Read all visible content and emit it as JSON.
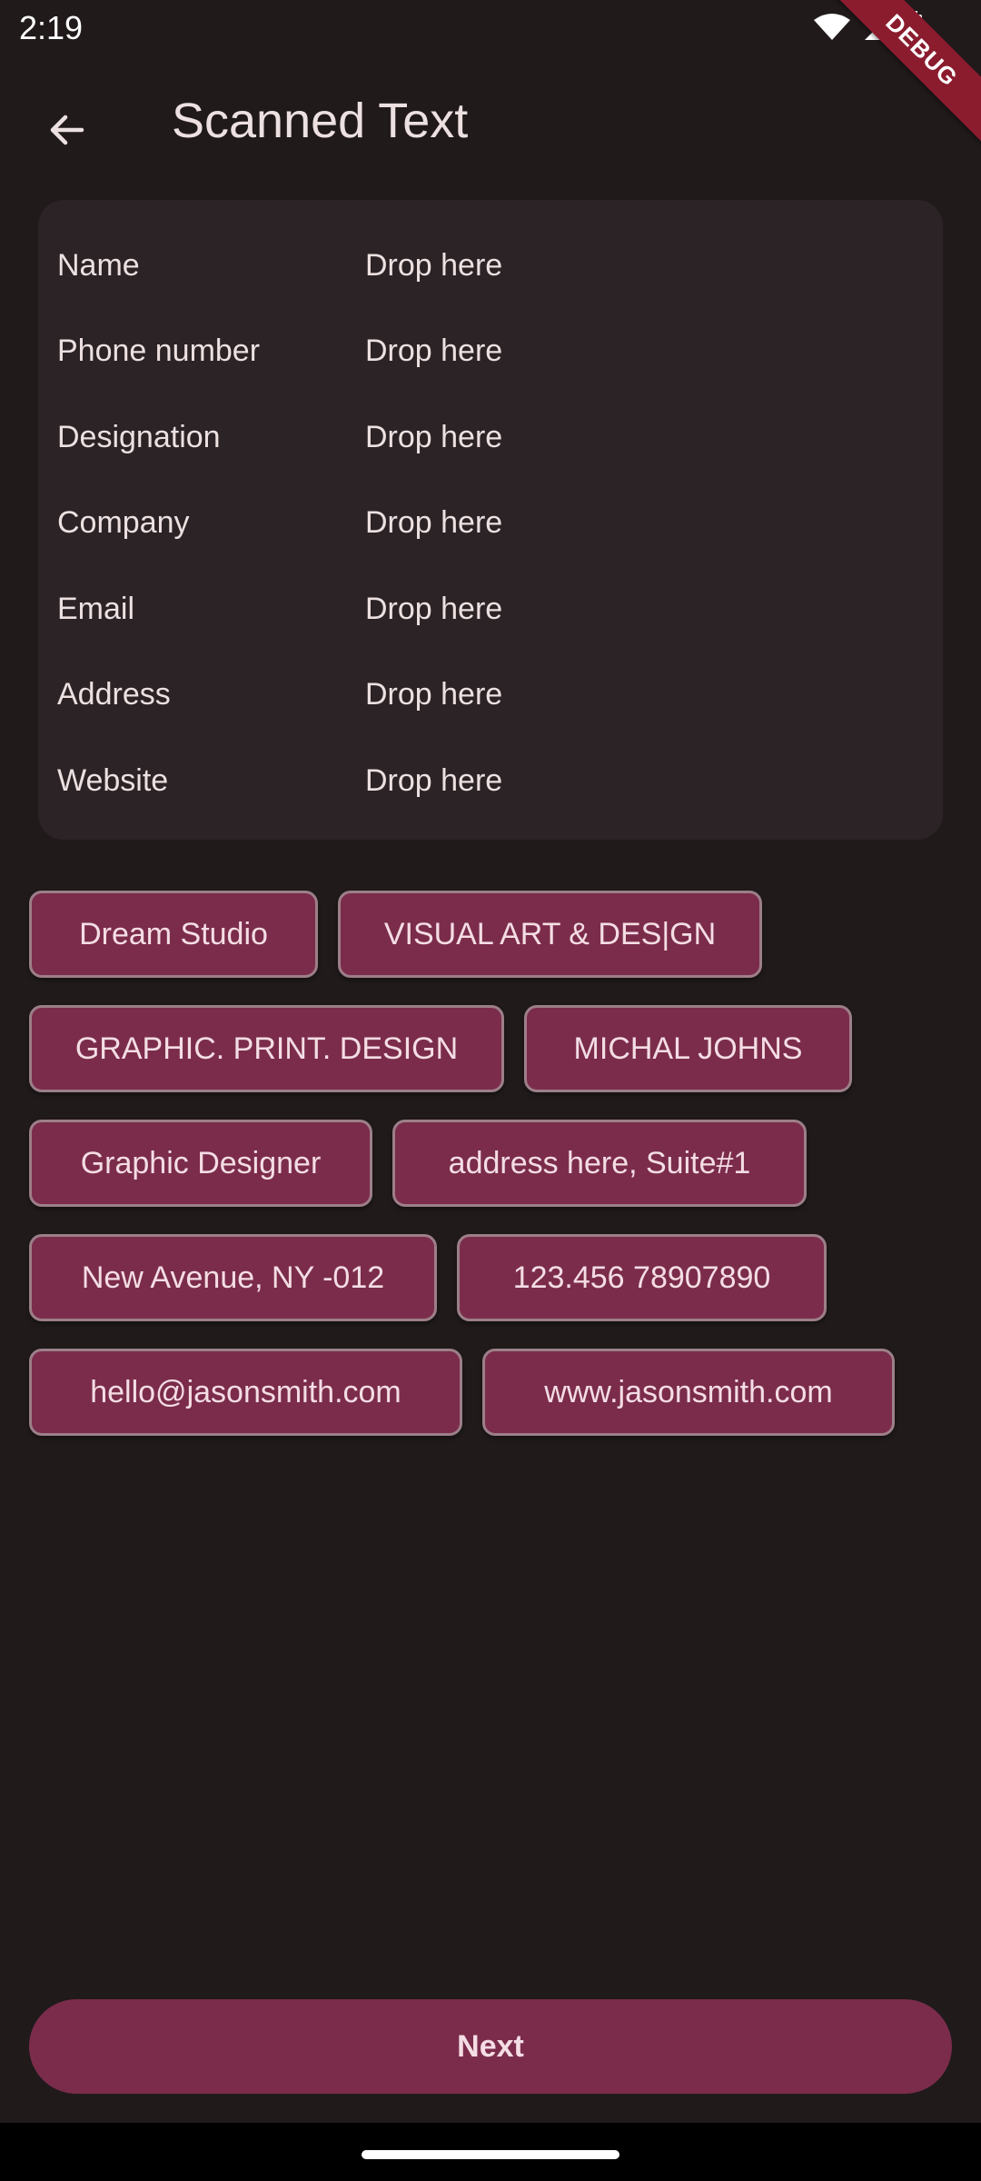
{
  "status_bar": {
    "time": "2:19"
  },
  "debug_banner": "DEBUG",
  "app_bar": {
    "title": "Scanned Text"
  },
  "fields": [
    {
      "label": "Name",
      "value": "Drop here"
    },
    {
      "label": "Phone number",
      "value": "Drop here"
    },
    {
      "label": "Designation",
      "value": "Drop here"
    },
    {
      "label": "Company",
      "value": "Drop here"
    },
    {
      "label": "Email",
      "value": "Drop here"
    },
    {
      "label": "Address",
      "value": "Drop here"
    },
    {
      "label": "Website",
      "value": "Drop here"
    }
  ],
  "chips": [
    "Dream Studio",
    "VISUAL ART & DES|GN",
    "GRAPHIC. PRINT. DESIGN",
    "MICHAL JOHNS",
    "Graphic Designer",
    "address here, Suite#1",
    "New Avenue, NY -012",
    "123.456 78907890",
    "hello@jasonsmith.com",
    "www.jasonsmith.com"
  ],
  "next_button": {
    "label": "Next"
  },
  "colors": {
    "background": "#201a1b",
    "card": "#2b2325",
    "accent": "#7b2c4b",
    "debug": "#8a1c2e"
  }
}
